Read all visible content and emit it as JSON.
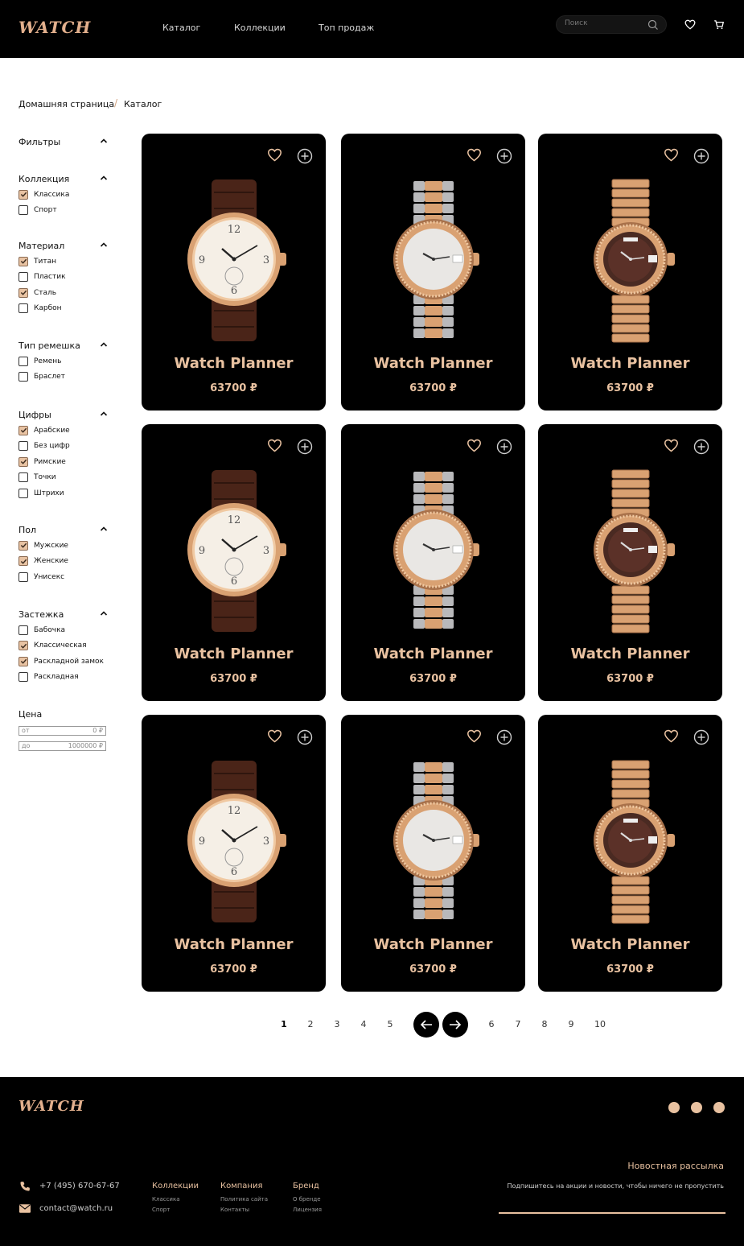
{
  "brand": {
    "logo": "WATCH",
    "accent": "#e8c1a0"
  },
  "header": {
    "nav": [
      "Каталог",
      "Коллекции",
      "Топ продаж"
    ],
    "search_placeholder": "Поиск",
    "icons": [
      "search-icon",
      "heart-icon",
      "cart-icon"
    ]
  },
  "breadcrumb": {
    "home": "Домашняя страница",
    "separator": "/",
    "current": "Каталог"
  },
  "filters": {
    "title": "Фильтры",
    "groups": [
      {
        "label": "Коллекция",
        "options": [
          {
            "label": "Классика",
            "checked": true
          },
          {
            "label": "Спорт",
            "checked": false
          }
        ]
      },
      {
        "label": "Материал",
        "options": [
          {
            "label": "Титан",
            "checked": true
          },
          {
            "label": "Пластик",
            "checked": false
          },
          {
            "label": "Сталь",
            "checked": true
          },
          {
            "label": "Карбон",
            "checked": false
          }
        ]
      },
      {
        "label": "Тип ремешка",
        "options": [
          {
            "label": "Ремень",
            "checked": false
          },
          {
            "label": "Браслет",
            "checked": false
          }
        ]
      },
      {
        "label": "Цифры",
        "options": [
          {
            "label": "Арабские",
            "checked": true
          },
          {
            "label": "Без цифр",
            "checked": false
          },
          {
            "label": "Римские",
            "checked": true
          },
          {
            "label": "Точки",
            "checked": false
          },
          {
            "label": "Штрихи",
            "checked": false
          }
        ]
      },
      {
        "label": "Пол",
        "options": [
          {
            "label": "Мужские",
            "checked": true
          },
          {
            "label": "Женские",
            "checked": true
          },
          {
            "label": "Унисекс",
            "checked": false
          }
        ]
      },
      {
        "label": "Застежка",
        "options": [
          {
            "label": "Бабочка",
            "checked": false
          },
          {
            "label": "Классическая",
            "checked": true
          },
          {
            "label": "Раскладной замок",
            "checked": true
          },
          {
            "label": "Раскладная",
            "checked": false
          }
        ]
      }
    ],
    "price": {
      "label": "Цена",
      "from_label": "от",
      "from_value": "0 ₽",
      "to_label": "до",
      "to_value": "1000000 ₽"
    }
  },
  "products": [
    {
      "name": "Watch Planner",
      "price": "63700 ₽",
      "style": "leather"
    },
    {
      "name": "Watch Planner",
      "price": "63700 ₽",
      "style": "twotone"
    },
    {
      "name": "Watch Planner",
      "price": "63700 ₽",
      "style": "gold"
    },
    {
      "name": "Watch Planner",
      "price": "63700 ₽",
      "style": "leather"
    },
    {
      "name": "Watch Planner",
      "price": "63700 ₽",
      "style": "twotone"
    },
    {
      "name": "Watch Planner",
      "price": "63700 ₽",
      "style": "gold"
    },
    {
      "name": "Watch Planner",
      "price": "63700 ₽",
      "style": "leather"
    },
    {
      "name": "Watch Planner",
      "price": "63700 ₽",
      "style": "twotone"
    },
    {
      "name": "Watch Planner",
      "price": "63700 ₽",
      "style": "gold"
    }
  ],
  "pagination": {
    "pages_left": [
      "1",
      "2",
      "3",
      "4",
      "5"
    ],
    "pages_right": [
      "6",
      "7",
      "8",
      "9",
      "10"
    ],
    "current": "1"
  },
  "footer": {
    "logo": "WATCH",
    "phone": "+7 (495) 670-67-67",
    "email": "contact@watch.ru",
    "columns": [
      {
        "title": "Коллекции",
        "items": [
          "Классика",
          "Спорт"
        ]
      },
      {
        "title": "Компания",
        "items": [
          "Политика сайта",
          "Контакты"
        ]
      },
      {
        "title": "Бренд",
        "items": [
          "О бренде",
          "Лицензия"
        ]
      }
    ],
    "newsletter": {
      "title": "Новостная рассылка",
      "text": "Подпишитесь на акции и новости, чтобы ничего не пропустить"
    },
    "social": [
      "instagram-icon",
      "vk-icon",
      "telegram-icon"
    ]
  }
}
